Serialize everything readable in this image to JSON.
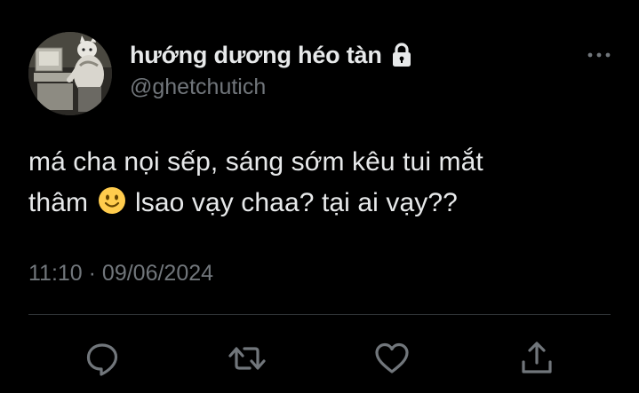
{
  "author": {
    "display_name": "hướng dương héo tàn",
    "handle": "@ghetchutich",
    "protected_icon": "lock-icon",
    "avatar": "avatar-image"
  },
  "tweet": {
    "text_line1": "má cha nọi sếp, sáng sớm kêu tui mắt",
    "text_line2_before": "thâm",
    "emoji": "slightly-smiling-face-emoji",
    "text_line2_after": "lsao vạy chaa? tại ai vạy??",
    "timestamp": "11:10 · 09/06/2024"
  },
  "actions": {
    "reply_icon": "reply-icon",
    "retweet_icon": "retweet-icon",
    "like_icon": "heart-icon",
    "share_icon": "share-icon",
    "more_icon": "more-horizontal-icon"
  },
  "colors": {
    "background": "#000000",
    "primary_text": "#e7e9ea",
    "secondary_text": "#71767b",
    "divider": "#2f3336"
  }
}
